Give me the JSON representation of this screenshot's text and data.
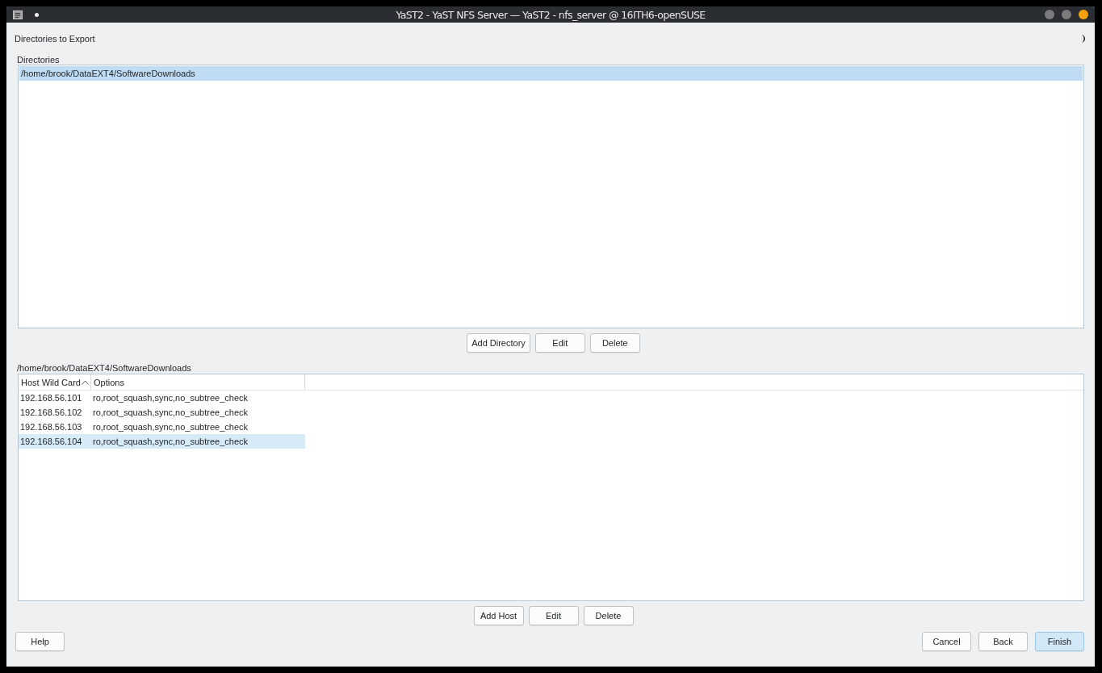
{
  "window": {
    "title": "YaST2 - YaST NFS Server — YaST2 - nfs_server @ 16ITH6-openSUSE"
  },
  "heading": "Directories to Export",
  "directories": {
    "label": "Directories",
    "items": [
      {
        "path": "/home/brook/DataEXT4/SoftwareDownloads",
        "selected": true
      }
    ],
    "buttons": [
      "Add Directory",
      "Edit",
      "Delete"
    ]
  },
  "hosts": {
    "label": "/home/brook/DataEXT4/SoftwareDownloads",
    "columns": [
      "Host Wild Card",
      "Options"
    ],
    "rows": [
      {
        "host": "192.168.56.101",
        "options": "ro,root_squash,sync,no_subtree_check",
        "selected": false
      },
      {
        "host": "192.168.56.102",
        "options": "ro,root_squash,sync,no_subtree_check",
        "selected": false
      },
      {
        "host": "192.168.56.103",
        "options": "ro,root_squash,sync,no_subtree_check",
        "selected": false
      },
      {
        "host": "192.168.56.104",
        "options": "ro,root_squash,sync,no_subtree_check",
        "selected": true
      }
    ],
    "buttons": [
      "Add Host",
      "Edit",
      "Delete"
    ]
  },
  "footer": {
    "left": [
      {
        "label": "Help",
        "default": false
      }
    ],
    "right": [
      {
        "label": "Cancel",
        "default": false
      },
      {
        "label": "Back",
        "default": false
      },
      {
        "label": "Finish",
        "default": true
      }
    ]
  }
}
